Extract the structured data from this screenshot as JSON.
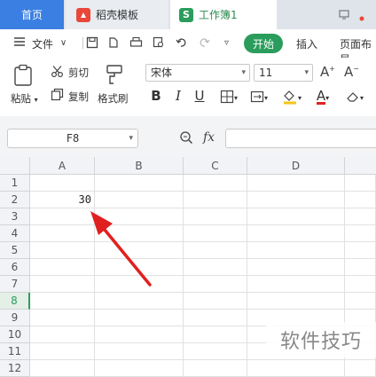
{
  "tabs": {
    "home": "首页",
    "template": "稻壳模板",
    "workbook": "工作簿1",
    "workbook_icon": "S"
  },
  "menu": {
    "file": "文件",
    "start": "开始",
    "insert": "插入",
    "page_layout": "页面布局"
  },
  "ribbon": {
    "paste": "粘贴",
    "cut": "剪切",
    "copy": "复制",
    "format_painter": "格式刷",
    "font_name": "宋体",
    "font_size": "11",
    "bold": "B",
    "italic": "I",
    "underline": "U",
    "font_color_letter": "A"
  },
  "formula_bar": {
    "name_box": "F8",
    "fx": "fx"
  },
  "sheet": {
    "columns": [
      "A",
      "B",
      "C",
      "D"
    ],
    "rows": [
      "1",
      "2",
      "3",
      "4",
      "5",
      "6",
      "7",
      "8",
      "9",
      "10",
      "11",
      "12"
    ],
    "active_row": "8",
    "cell_A2": "30"
  },
  "watermark": "软件技巧",
  "colors": {
    "accent_green": "#2a9d5c",
    "home_tab_blue": "#3a7fe1",
    "arrow_red": "#e02020"
  }
}
